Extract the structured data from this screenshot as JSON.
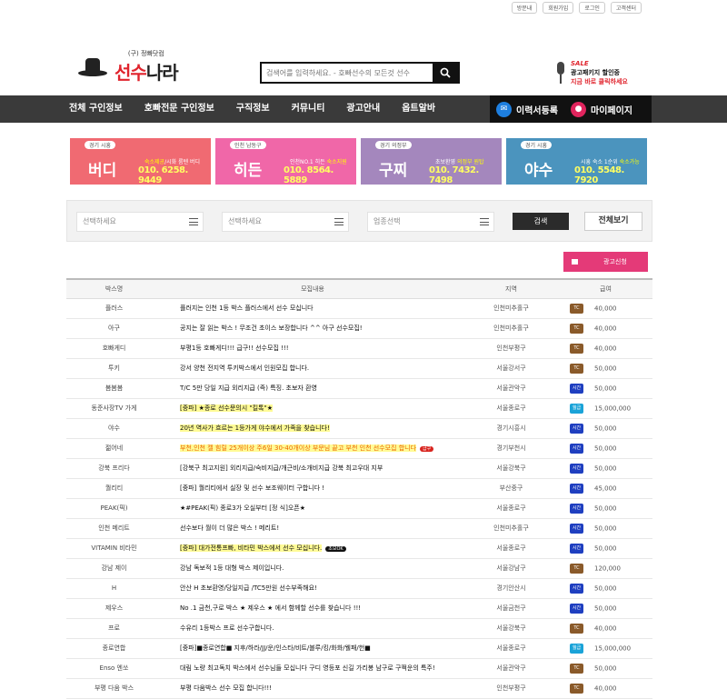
{
  "top_links": [
    "방문내",
    "회원가입",
    "로그인",
    "고객센터"
  ],
  "logo": {
    "subtitle": "(구) 정빠닷컴",
    "name_red": "선수",
    "name_black": "나라"
  },
  "search": {
    "placeholder": "검색어를 입력하세요. - 호빠선수의 모든것 선수"
  },
  "promo": {
    "sale": "SALE",
    "line1": "광고패키지 할인중",
    "line2": "지금 바로 클릭하세요"
  },
  "nav": {
    "items": [
      "전체 구인정보",
      "호빠전문 구인정보",
      "구직정보",
      "커뮤니티",
      "광고안내",
      "옵트알바"
    ],
    "resume_label": "이력서등록",
    "mypage_label": "마이페이지"
  },
  "banners": [
    {
      "tag": "경기 시흥",
      "name": "버디",
      "desc_a": "숙소제공",
      "desc_b": "/시화 룸텐 버디",
      "phone": "010. 6258. 9449"
    },
    {
      "tag": "인천 남동구",
      "name": "히든",
      "desc_a": "인천NO.1 히든 ",
      "desc_b": "숙소지원",
      "phone": "010. 8564. 5889"
    },
    {
      "tag": "경기 의정부",
      "name": "구찌",
      "desc_a": "초보환영 ",
      "desc_b": "의정부 원탑",
      "phone": "010. 7432. 7498"
    },
    {
      "tag": "경기 시흥",
      "name": "야수",
      "desc_a": "시흥 숙소 1순위 ",
      "desc_b": "숙소가능",
      "phone": "010. 5548. 7920"
    }
  ],
  "filter": {
    "select1": "선택하세요",
    "select2": "선택하세요",
    "select3": "업종선택",
    "search_label": "검색",
    "all_label": "전체보기"
  },
  "ad_button": "광고신청",
  "table": {
    "headers": [
      "박스명",
      "모집내용",
      "지역",
      "급여"
    ],
    "rows": [
      {
        "box": "플러스",
        "content": "플러지는 인천 1등 박스 플러스에서 선수 모십니다",
        "region": "인천미추홀구",
        "pay_type": "TC",
        "pay": "40,000",
        "style": ""
      },
      {
        "box": "아구",
        "content": "공지는 잘 읽는 박스 ! 무조건 초이스 보장합니다 ^^ 아구 선수모집!",
        "region": "인천미추홀구",
        "pay_type": "TC",
        "pay": "40,000",
        "style": ""
      },
      {
        "box": "호빠게디",
        "content": "부평1등 호빠게디!!! 급구!! 선수모집 !!!",
        "region": "인천부평구",
        "pay_type": "TC",
        "pay": "40,000",
        "style": ""
      },
      {
        "box": "투키",
        "content": "강서 양천 전지역 투키박스에서 인원모집 합니다.",
        "region": "서울강서구",
        "pay_type": "TC",
        "pay": "50,000",
        "style": ""
      },
      {
        "box": "봄봄봄",
        "content": "T/C 5만 당일 지급 외리지급 (즉) 특징. 초보자 환영",
        "region": "서울관악구",
        "pay_type": "시간",
        "pay": "50,000",
        "style": ""
      },
      {
        "box": "동준사장TV 가게",
        "content": "[중파] ★종로 선수문의시 \"킬톡\"★",
        "region": "서울종로구",
        "pay_type": "월급",
        "pay": "15,000,000",
        "style": "y"
      },
      {
        "box": "야수",
        "content": "20년 역사가 흐르는 1등가게 야수에서 가족을 찾습니다!",
        "region": "경기시흥시",
        "pay_type": "시간",
        "pay": "50,000",
        "style": "y"
      },
      {
        "box": "젊어네",
        "content": "부천,인천 젤 힘릴 25개이상 주6일 30-40개이상 부문님 끝고 부천 인천 선수모집 합니다",
        "region": "경기부천시",
        "pay_type": "시간",
        "pay": "50,000",
        "style": "o",
        "badge": "급구"
      },
      {
        "box": "강북 프리다",
        "content": "[강북구 최고지원] 외리지급/숙비지급/개근비/소개비지급 강북 최고우대 지부",
        "region": "서울강북구",
        "pay_type": "시간",
        "pay": "50,000",
        "style": ""
      },
      {
        "box": "퀄리티",
        "content": "[중파] 퀄리티에서 실장 및 선수 보조웨이터 구합니다 !",
        "region": "부산중구",
        "pay_type": "시간",
        "pay": "45,000",
        "style": ""
      },
      {
        "box": "PEAK(픽)",
        "content": "★#PEAK(픽) 종로3가 오실부터 [정 식]오픈★",
        "region": "서울종로구",
        "pay_type": "시간",
        "pay": "50,000",
        "style": ""
      },
      {
        "box": "인천 메리트",
        "content": "선수보다 월이 더 많은 박스 ! 메리트!",
        "region": "인천미추홀구",
        "pay_type": "시간",
        "pay": "50,000",
        "style": ""
      },
      {
        "box": "VITAMIN 비타민",
        "content": "[중파] 대가전통프빠, 비타민 박스에서 선수 모십니다.",
        "region": "서울종로구",
        "pay_type": "시간",
        "pay": "50,000",
        "style": "y",
        "badge_ok": "초보OK"
      },
      {
        "box": "강남 제이",
        "content": "강남 독보적 1등 대형 박스 제이입니다.",
        "region": "서울강남구",
        "pay_type": "TC",
        "pay": "120,000",
        "style": ""
      },
      {
        "box": "H",
        "content": "안산 H 초보환영/당일지급 /TC5만원 선수부족해요!",
        "region": "경기안산시",
        "pay_type": "시간",
        "pay": "50,000",
        "style": ""
      },
      {
        "box": "제우스",
        "content": "No .1 금천,구로 박스 ★ 제우스 ★ 에서 함께할 선수를 찾습니다 !!!",
        "region": "서울금천구",
        "pay_type": "시간",
        "pay": "50,000",
        "style": ""
      },
      {
        "box": "프로",
        "content": "수유리 1등박스 프로 선수구합니다.",
        "region": "서울강북구",
        "pay_type": "TC",
        "pay": "40,000",
        "style": ""
      },
      {
        "box": "종로연합",
        "content": "[중파]■종로연합■ 지후/하라/JJ/운/인스타/비트/블루/킹/화화/웰패/헌■",
        "region": "서울종로구",
        "pay_type": "월급",
        "pay": "15,000,000",
        "style": ""
      },
      {
        "box": "Enso 엔쏘",
        "content": "대림 노량 최고독치 박스에서 선수님들 모십니다 구디 영등포 신길 가리봉 남구로 구쩍운의 특주!",
        "region": "서울관악구",
        "pay_type": "TC",
        "pay": "50,000",
        "style": ""
      },
      {
        "box": "부평 다움 박스",
        "content": "부평 다움박스 선수 모집 합니다!!!",
        "region": "인천부평구",
        "pay_type": "TC",
        "pay": "40,000",
        "style": ""
      }
    ]
  }
}
